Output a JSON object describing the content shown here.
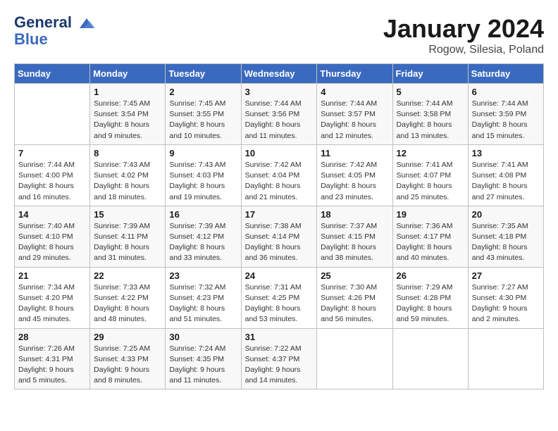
{
  "header": {
    "logo_line1": "General",
    "logo_line2": "Blue",
    "month": "January 2024",
    "location": "Rogow, Silesia, Poland"
  },
  "weekdays": [
    "Sunday",
    "Monday",
    "Tuesday",
    "Wednesday",
    "Thursday",
    "Friday",
    "Saturday"
  ],
  "weeks": [
    [
      {
        "day": "",
        "sunrise": "",
        "sunset": "",
        "daylight": ""
      },
      {
        "day": "1",
        "sunrise": "Sunrise: 7:45 AM",
        "sunset": "Sunset: 3:54 PM",
        "daylight": "Daylight: 8 hours and 9 minutes."
      },
      {
        "day": "2",
        "sunrise": "Sunrise: 7:45 AM",
        "sunset": "Sunset: 3:55 PM",
        "daylight": "Daylight: 8 hours and 10 minutes."
      },
      {
        "day": "3",
        "sunrise": "Sunrise: 7:44 AM",
        "sunset": "Sunset: 3:56 PM",
        "daylight": "Daylight: 8 hours and 11 minutes."
      },
      {
        "day": "4",
        "sunrise": "Sunrise: 7:44 AM",
        "sunset": "Sunset: 3:57 PM",
        "daylight": "Daylight: 8 hours and 12 minutes."
      },
      {
        "day": "5",
        "sunrise": "Sunrise: 7:44 AM",
        "sunset": "Sunset: 3:58 PM",
        "daylight": "Daylight: 8 hours and 13 minutes."
      },
      {
        "day": "6",
        "sunrise": "Sunrise: 7:44 AM",
        "sunset": "Sunset: 3:59 PM",
        "daylight": "Daylight: 8 hours and 15 minutes."
      }
    ],
    [
      {
        "day": "7",
        "sunrise": "Sunrise: 7:44 AM",
        "sunset": "Sunset: 4:00 PM",
        "daylight": "Daylight: 8 hours and 16 minutes."
      },
      {
        "day": "8",
        "sunrise": "Sunrise: 7:43 AM",
        "sunset": "Sunset: 4:02 PM",
        "daylight": "Daylight: 8 hours and 18 minutes."
      },
      {
        "day": "9",
        "sunrise": "Sunrise: 7:43 AM",
        "sunset": "Sunset: 4:03 PM",
        "daylight": "Daylight: 8 hours and 19 minutes."
      },
      {
        "day": "10",
        "sunrise": "Sunrise: 7:42 AM",
        "sunset": "Sunset: 4:04 PM",
        "daylight": "Daylight: 8 hours and 21 minutes."
      },
      {
        "day": "11",
        "sunrise": "Sunrise: 7:42 AM",
        "sunset": "Sunset: 4:05 PM",
        "daylight": "Daylight: 8 hours and 23 minutes."
      },
      {
        "day": "12",
        "sunrise": "Sunrise: 7:41 AM",
        "sunset": "Sunset: 4:07 PM",
        "daylight": "Daylight: 8 hours and 25 minutes."
      },
      {
        "day": "13",
        "sunrise": "Sunrise: 7:41 AM",
        "sunset": "Sunset: 4:08 PM",
        "daylight": "Daylight: 8 hours and 27 minutes."
      }
    ],
    [
      {
        "day": "14",
        "sunrise": "Sunrise: 7:40 AM",
        "sunset": "Sunset: 4:10 PM",
        "daylight": "Daylight: 8 hours and 29 minutes."
      },
      {
        "day": "15",
        "sunrise": "Sunrise: 7:39 AM",
        "sunset": "Sunset: 4:11 PM",
        "daylight": "Daylight: 8 hours and 31 minutes."
      },
      {
        "day": "16",
        "sunrise": "Sunrise: 7:39 AM",
        "sunset": "Sunset: 4:12 PM",
        "daylight": "Daylight: 8 hours and 33 minutes."
      },
      {
        "day": "17",
        "sunrise": "Sunrise: 7:38 AM",
        "sunset": "Sunset: 4:14 PM",
        "daylight": "Daylight: 8 hours and 36 minutes."
      },
      {
        "day": "18",
        "sunrise": "Sunrise: 7:37 AM",
        "sunset": "Sunset: 4:15 PM",
        "daylight": "Daylight: 8 hours and 38 minutes."
      },
      {
        "day": "19",
        "sunrise": "Sunrise: 7:36 AM",
        "sunset": "Sunset: 4:17 PM",
        "daylight": "Daylight: 8 hours and 40 minutes."
      },
      {
        "day": "20",
        "sunrise": "Sunrise: 7:35 AM",
        "sunset": "Sunset: 4:18 PM",
        "daylight": "Daylight: 8 hours and 43 minutes."
      }
    ],
    [
      {
        "day": "21",
        "sunrise": "Sunrise: 7:34 AM",
        "sunset": "Sunset: 4:20 PM",
        "daylight": "Daylight: 8 hours and 45 minutes."
      },
      {
        "day": "22",
        "sunrise": "Sunrise: 7:33 AM",
        "sunset": "Sunset: 4:22 PM",
        "daylight": "Daylight: 8 hours and 48 minutes."
      },
      {
        "day": "23",
        "sunrise": "Sunrise: 7:32 AM",
        "sunset": "Sunset: 4:23 PM",
        "daylight": "Daylight: 8 hours and 51 minutes."
      },
      {
        "day": "24",
        "sunrise": "Sunrise: 7:31 AM",
        "sunset": "Sunset: 4:25 PM",
        "daylight": "Daylight: 8 hours and 53 minutes."
      },
      {
        "day": "25",
        "sunrise": "Sunrise: 7:30 AM",
        "sunset": "Sunset: 4:26 PM",
        "daylight": "Daylight: 8 hours and 56 minutes."
      },
      {
        "day": "26",
        "sunrise": "Sunrise: 7:29 AM",
        "sunset": "Sunset: 4:28 PM",
        "daylight": "Daylight: 8 hours and 59 minutes."
      },
      {
        "day": "27",
        "sunrise": "Sunrise: 7:27 AM",
        "sunset": "Sunset: 4:30 PM",
        "daylight": "Daylight: 9 hours and 2 minutes."
      }
    ],
    [
      {
        "day": "28",
        "sunrise": "Sunrise: 7:26 AM",
        "sunset": "Sunset: 4:31 PM",
        "daylight": "Daylight: 9 hours and 5 minutes."
      },
      {
        "day": "29",
        "sunrise": "Sunrise: 7:25 AM",
        "sunset": "Sunset: 4:33 PM",
        "daylight": "Daylight: 9 hours and 8 minutes."
      },
      {
        "day": "30",
        "sunrise": "Sunrise: 7:24 AM",
        "sunset": "Sunset: 4:35 PM",
        "daylight": "Daylight: 9 hours and 11 minutes."
      },
      {
        "day": "31",
        "sunrise": "Sunrise: 7:22 AM",
        "sunset": "Sunset: 4:37 PM",
        "daylight": "Daylight: 9 hours and 14 minutes."
      },
      {
        "day": "",
        "sunrise": "",
        "sunset": "",
        "daylight": ""
      },
      {
        "day": "",
        "sunrise": "",
        "sunset": "",
        "daylight": ""
      },
      {
        "day": "",
        "sunrise": "",
        "sunset": "",
        "daylight": ""
      }
    ]
  ]
}
